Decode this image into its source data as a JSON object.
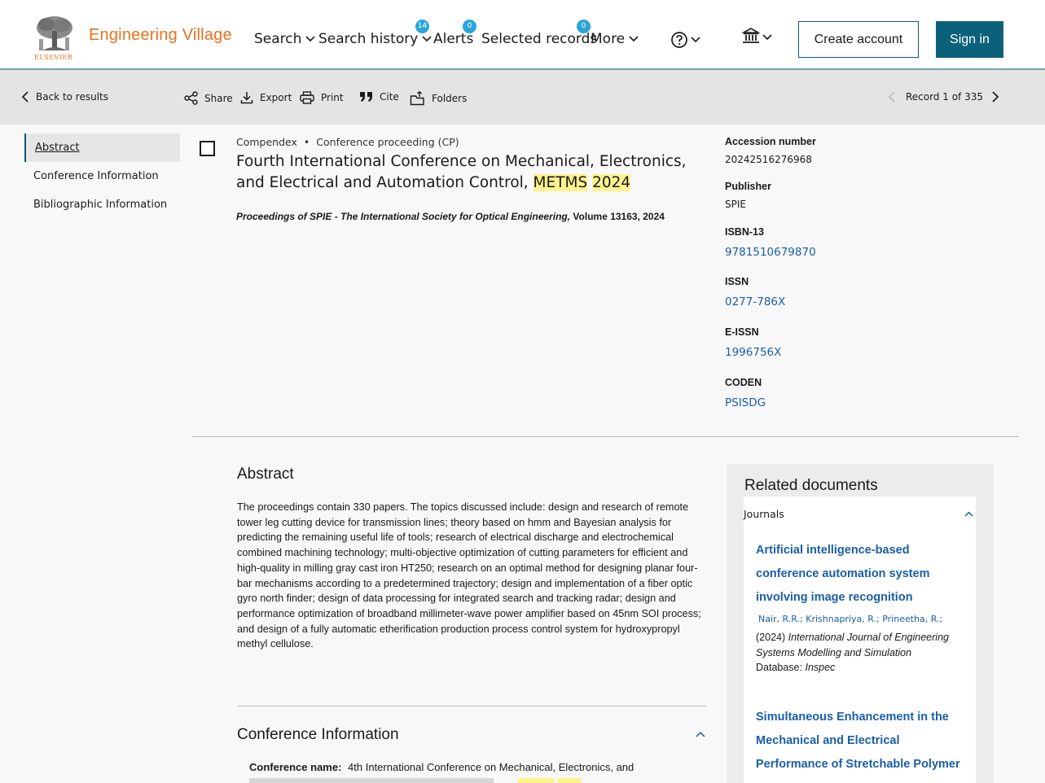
{
  "brand": {
    "logo_word": "ELSEVIER",
    "name": "Engineering Village"
  },
  "nav": {
    "search": "Search",
    "search_history": "Search history",
    "search_history_count": "14",
    "alerts": "Alerts",
    "alerts_count": "0",
    "selected_records": "Selected records",
    "selected_count": "0",
    "more": "More",
    "create_account": "Create account",
    "sign_in": "Sign in"
  },
  "toolbar": {
    "back": "Back to results",
    "share": "Share",
    "export": "Export",
    "print": "Print",
    "cite": "Cite",
    "folders": "Folders",
    "record_position": "Record 1 of 335"
  },
  "sidebar": {
    "items": [
      {
        "label": "Abstract"
      },
      {
        "label": "Conference Information"
      },
      {
        "label": "Bibliographic Information"
      }
    ]
  },
  "record": {
    "database": "Compendex",
    "doc_type": "Conference proceeding (CP)",
    "title_part1": "Fourth International Conference on Mechanical, Electronics, and Electrical and Automation Control, ",
    "title_hl1": "METMS",
    "title_hl2": "2024",
    "source_title": "Proceedings of SPIE - The International Society for Optical Engineering,",
    "source_volume": " Volume 13163, 2024"
  },
  "fields": {
    "accession_label": "Accession number",
    "accession_value": "20242516276968",
    "publisher_label": "Publisher",
    "publisher_value": "SPIE",
    "isbn_label": "ISBN-13",
    "isbn_value": "9781510679870",
    "issn_label": "ISSN",
    "issn_value": "0277-786X",
    "eissn_label": "E-ISSN",
    "eissn_value": "1996756X",
    "coden_label": "CODEN",
    "coden_value": "PSISDG"
  },
  "abstract": {
    "heading": "Abstract",
    "text": "The proceedings contain 330 papers. The topics discussed include: design and research of remote tower leg cutting device for transmission lines; theory based on hmm and Bayesian analysis for predicting the remaining useful life of tools; research of electrical discharge and electrochemical combined machining technology; multi-objective optimization of cutting parameters for efficient and high-quality in milling gray cast iron HT250; research on an optimal method for designing planar four-bar mechanisms according to a predetermined trajectory; design and implementation of a fiber optic gyro north finder; design of data processing for integrated search and tracking radar; design and performance optimization of broadband millimeter-wave power amplifier based on 45nm SOI process; and design of a fully automatic etherification production process control system for hydroxypropyl methyl cellulose."
  },
  "conference": {
    "heading": "Conference Information",
    "name_label": "Conference name:",
    "name_value": "4th International Conference on Mechanical, Electronics, and"
  },
  "related": {
    "heading": "Related documents",
    "category": "Journals",
    "docs": [
      {
        "title": "Artificial intelligence-based conference automation system involving image recognition",
        "authors": "Nair, R.R.;  Krishnapriya, R.;  Prineetha, R.;",
        "year": "(2024)",
        "journal": "International Journal of Engineering Systems Modelling and Simulation",
        "database_label": "Database:",
        "database_value": "Inspec"
      },
      {
        "title": "Simultaneous Enhancement in the Mechanical and Electrical Performance of Stretchable Polymer"
      }
    ]
  },
  "colors": {
    "brand_orange": "#e9711c",
    "primary_teal": "#0b6179",
    "link_blue": "#1a5ea8",
    "badge_blue": "#2ba6d8",
    "highlight": "#fff38f"
  }
}
